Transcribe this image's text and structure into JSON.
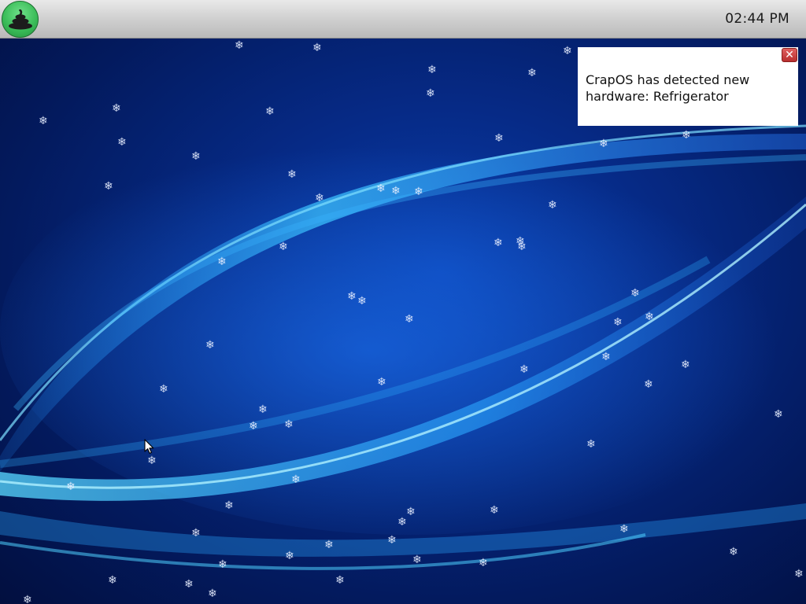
{
  "top_panel": {
    "start_icon": "poop-pile-icon",
    "clock": "02:44 PM"
  },
  "notification": {
    "message": "CrapOS has detected new hardware: Refrigerator",
    "close_icon": "close-icon"
  },
  "desktop": {
    "wallpaper": "blue-swoosh-wallpaper",
    "snowflake_glyph": "❄",
    "cursor_icon": "arrow-cursor-icon"
  },
  "colors": {
    "panel": "#d2d2d2",
    "start_button": "#3bbd59",
    "wallpaper_dark": "#031a5e",
    "swoosh_light": "#39c6ff",
    "close_button": "#c23a3a"
  }
}
